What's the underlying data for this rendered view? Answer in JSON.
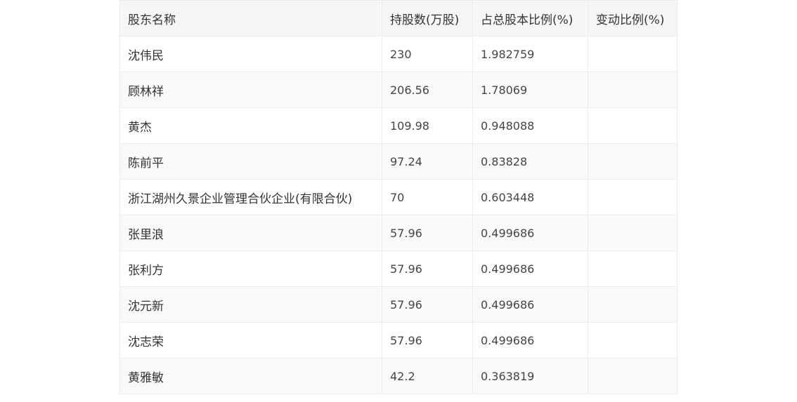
{
  "table": {
    "headers": [
      "股东名称",
      "持股数(万股)",
      "占总股本比例(%)",
      "变动比例(%)"
    ],
    "rows": [
      [
        "沈伟民",
        "230",
        "1.982759",
        ""
      ],
      [
        "顾林祥",
        "206.56",
        "1.78069",
        ""
      ],
      [
        "黄杰",
        "109.98",
        "0.948088",
        ""
      ],
      [
        "陈前平",
        "97.24",
        "0.83828",
        ""
      ],
      [
        "浙江湖州久景企业管理合伙企业(有限合伙)",
        "70",
        "0.603448",
        ""
      ],
      [
        "张里浪",
        "57.96",
        "0.499686",
        ""
      ],
      [
        "张利方",
        "57.96",
        "0.499686",
        ""
      ],
      [
        "沈元新",
        "57.96",
        "0.499686",
        ""
      ],
      [
        "沈志荣",
        "57.96",
        "0.499686",
        ""
      ],
      [
        "黄雅敏",
        "42.2",
        "0.363819",
        ""
      ]
    ]
  }
}
